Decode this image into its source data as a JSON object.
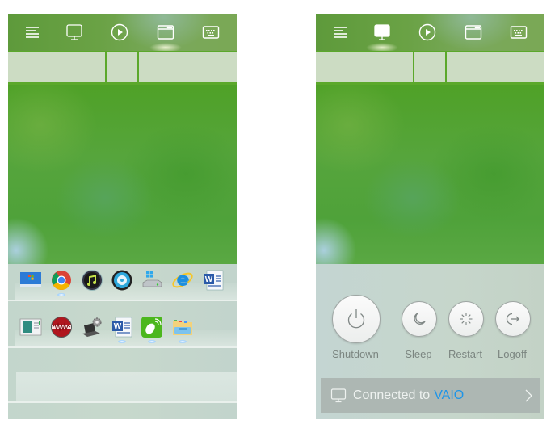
{
  "toolbar": {
    "icons": [
      {
        "name": "menu-icon"
      },
      {
        "name": "monitor-icon"
      },
      {
        "name": "play-icon"
      },
      {
        "name": "window-icon"
      },
      {
        "name": "keyboard-icon"
      }
    ]
  },
  "left_screen": {
    "active_tab": "window-icon",
    "dock": {
      "row1": [
        {
          "name": "windows-desktop-icon",
          "running": false
        },
        {
          "name": "chrome-icon",
          "running": true
        },
        {
          "name": "music-player-icon",
          "running": false
        },
        {
          "name": "dvd-player-icon",
          "running": false
        },
        {
          "name": "windows-drive-icon",
          "running": false
        },
        {
          "name": "internet-explorer-icon",
          "running": false
        },
        {
          "name": "word-document-icon",
          "running": false
        }
      ],
      "row2": [
        {
          "name": "app-window-icon",
          "running": false
        },
        {
          "name": "audio-recorder-icon",
          "running": false
        },
        {
          "name": "laptop-settings-icon",
          "running": false
        },
        {
          "name": "word-icon",
          "running": true
        },
        {
          "name": "remote-mouse-icon",
          "running": true
        },
        {
          "name": "file-explorer-icon",
          "running": true
        }
      ]
    }
  },
  "right_screen": {
    "active_tab": "monitor-icon",
    "power_actions": [
      {
        "id": "shutdown",
        "label": "Shutdown",
        "icon": "power-icon"
      },
      {
        "id": "sleep",
        "label": "Sleep",
        "icon": "moon-icon"
      },
      {
        "id": "restart",
        "label": "Restart",
        "icon": "restart-spinner-icon"
      },
      {
        "id": "logoff",
        "label": "Logoff",
        "icon": "logoff-arrow-icon"
      }
    ],
    "connection": {
      "prefix": "Connected to",
      "host": "VAIO",
      "host_color": "#1e95e8"
    }
  }
}
